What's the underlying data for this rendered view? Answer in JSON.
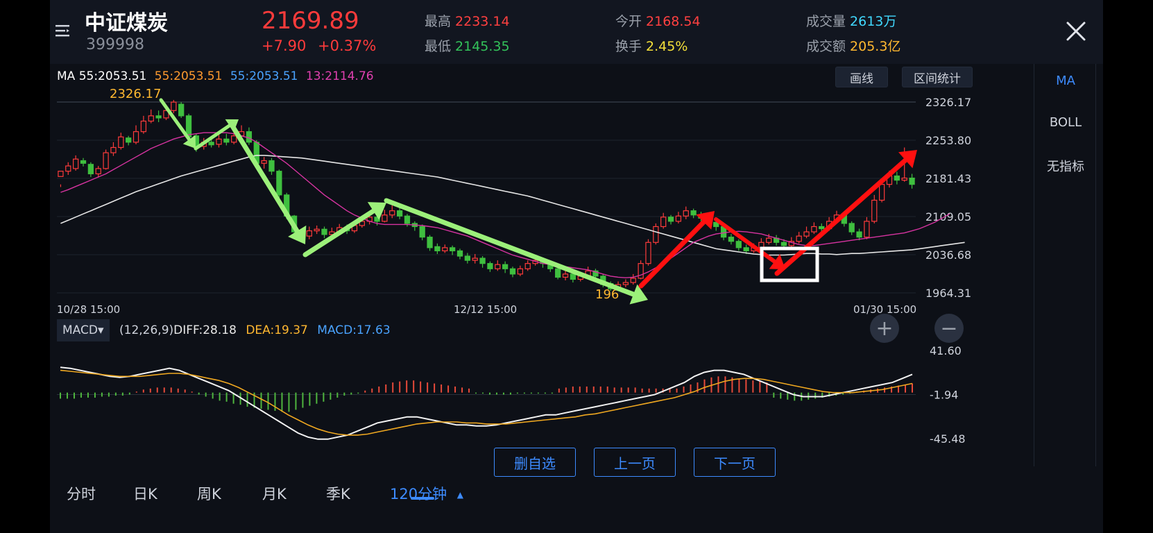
{
  "header": {
    "stock_name": "中证煤炭",
    "stock_code": "399998",
    "price": "2169.89",
    "change": "+7.90",
    "change_pct": "+0.37%",
    "high_label": "最高",
    "high_value": "2233.14",
    "low_label": "最低",
    "low_value": "2145.35",
    "open_label": "今开",
    "open_value": "2168.54",
    "turnover_label": "换手",
    "turnover_value": "2.45%",
    "volume_label": "成交量",
    "volume_value": "2613万",
    "amount_label": "成交额",
    "amount_value": "205.3亿"
  },
  "legend": {
    "ma_prefix": "MA 55:2053.51",
    "ma_orange": "55:2053.51",
    "ma_blue": "55:2053.51",
    "ma_pink": "13:2114.76"
  },
  "toolbar": {
    "draw_label": "画线",
    "range_label": "区间统计"
  },
  "side": {
    "items": [
      "MA",
      "BOLL",
      "无指标"
    ]
  },
  "chart_data": {
    "type": "candlestick",
    "y_ticks": [
      "2326.17",
      "2253.80",
      "2181.43",
      "2109.05",
      "2036.68",
      "1964.31"
    ],
    "y_range": [
      1964.31,
      2326.17
    ],
    "x_labels": [
      "10/28  15:00",
      "12/12  15:00",
      "01/30  15:00"
    ],
    "high_label": "2326.17",
    "low_label": "196",
    "candles": [
      [
        2185,
        2195,
        2170,
        2165
      ],
      [
        2195,
        2205,
        2212,
        2188
      ],
      [
        2200,
        2218,
        2225,
        2196
      ],
      [
        2215,
        2210,
        2220,
        2204
      ],
      [
        2208,
        2190,
        2212,
        2184
      ],
      [
        2190,
        2200,
        2205,
        2183
      ],
      [
        2200,
        2230,
        2236,
        2198
      ],
      [
        2230,
        2240,
        2250,
        2224
      ],
      [
        2240,
        2260,
        2268,
        2236
      ],
      [
        2258,
        2250,
        2262,
        2244
      ],
      [
        2250,
        2270,
        2282,
        2246
      ],
      [
        2270,
        2290,
        2300,
        2266
      ],
      [
        2290,
        2300,
        2312,
        2286
      ],
      [
        2300,
        2296,
        2310,
        2288
      ],
      [
        2296,
        2310,
        2320,
        2292
      ],
      [
        2310,
        2326,
        2330,
        2305
      ],
      [
        2322,
        2300,
        2326,
        2296
      ],
      [
        2300,
        2260,
        2304,
        2255
      ],
      [
        2262,
        2240,
        2266,
        2232
      ],
      [
        2242,
        2250,
        2258,
        2236
      ],
      [
        2250,
        2245,
        2256,
        2240
      ],
      [
        2246,
        2256,
        2264,
        2240
      ],
      [
        2256,
        2250,
        2266,
        2244
      ],
      [
        2250,
        2262,
        2270,
        2246
      ],
      [
        2262,
        2270,
        2282,
        2256
      ],
      [
        2270,
        2250,
        2278,
        2245
      ],
      [
        2250,
        2210,
        2254,
        2205
      ],
      [
        2210,
        2215,
        2222,
        2200
      ],
      [
        2215,
        2195,
        2220,
        2188
      ],
      [
        2195,
        2150,
        2198,
        2144
      ],
      [
        2150,
        2110,
        2154,
        2104
      ],
      [
        2110,
        2080,
        2112,
        2072
      ],
      [
        2082,
        2070,
        2086,
        2062
      ],
      [
        2072,
        2082,
        2090,
        2066
      ],
      [
        2082,
        2085,
        2092,
        2076
      ],
      [
        2085,
        2075,
        2090,
        2068
      ],
      [
        2075,
        2080,
        2088,
        2070
      ],
      [
        2080,
        2088,
        2095,
        2074
      ],
      [
        2088,
        2082,
        2094,
        2076
      ],
      [
        2082,
        2092,
        2098,
        2078
      ],
      [
        2092,
        2100,
        2108,
        2088
      ],
      [
        2100,
        2108,
        2116,
        2094
      ],
      [
        2108,
        2100,
        2112,
        2092
      ],
      [
        2100,
        2112,
        2122,
        2098
      ],
      [
        2112,
        2120,
        2130,
        2106
      ],
      [
        2120,
        2110,
        2126,
        2104
      ],
      [
        2110,
        2096,
        2114,
        2090
      ],
      [
        2096,
        2090,
        2100,
        2082
      ],
      [
        2090,
        2070,
        2094,
        2064
      ],
      [
        2070,
        2050,
        2074,
        2044
      ],
      [
        2052,
        2044,
        2058,
        2038
      ],
      [
        2044,
        2050,
        2056,
        2040
      ],
      [
        2050,
        2044,
        2054,
        2036
      ],
      [
        2044,
        2034,
        2048,
        2028
      ],
      [
        2034,
        2026,
        2040,
        2020
      ],
      [
        2026,
        2030,
        2038,
        2020
      ],
      [
        2030,
        2020,
        2034,
        2012
      ],
      [
        2020,
        2010,
        2024,
        2004
      ],
      [
        2010,
        2018,
        2026,
        2006
      ],
      [
        2018,
        2010,
        2024,
        2002
      ],
      [
        2010,
        2000,
        2014,
        1994
      ],
      [
        2000,
        2010,
        2016,
        1996
      ],
      [
        2010,
        2020,
        2026,
        2006
      ],
      [
        2020,
        2026,
        2034,
        2016
      ],
      [
        2026,
        2020,
        2030,
        2012
      ],
      [
        2020,
        2010,
        2026,
        2004
      ],
      [
        2010,
        1994,
        2014,
        1990
      ],
      [
        1994,
        2000,
        2006,
        1988
      ],
      [
        2000,
        1990,
        2004,
        1984
      ],
      [
        1990,
        1996,
        2002,
        1986
      ],
      [
        1996,
        2006,
        2014,
        1992
      ],
      [
        2006,
        1996,
        2010,
        1986
      ],
      [
        1996,
        1980,
        2000,
        1975
      ],
      [
        1982,
        1972,
        1986,
        1968
      ],
      [
        1972,
        1980,
        1986,
        1968
      ],
      [
        1980,
        1984,
        1990,
        1975
      ],
      [
        1984,
        1992,
        2000,
        1980
      ],
      [
        1992,
        2020,
        2026,
        1990
      ],
      [
        2020,
        2060,
        2066,
        2016
      ],
      [
        2060,
        2090,
        2096,
        2056
      ],
      [
        2090,
        2108,
        2116,
        2086
      ],
      [
        2108,
        2100,
        2112,
        2094
      ],
      [
        2100,
        2110,
        2118,
        2096
      ],
      [
        2110,
        2120,
        2128,
        2104
      ],
      [
        2120,
        2112,
        2124,
        2106
      ],
      [
        2112,
        2106,
        2118,
        2100
      ],
      [
        2106,
        2098,
        2110,
        2092
      ],
      [
        2098,
        2090,
        2102,
        2082
      ],
      [
        2090,
        2070,
        2094,
        2064
      ],
      [
        2070,
        2062,
        2076,
        2056
      ],
      [
        2062,
        2050,
        2066,
        2044
      ],
      [
        2050,
        2044,
        2056,
        2038
      ],
      [
        2044,
        2050,
        2058,
        2040
      ],
      [
        2050,
        2060,
        2068,
        2046
      ],
      [
        2060,
        2068,
        2076,
        2056
      ],
      [
        2068,
        2060,
        2074,
        2054
      ],
      [
        2060,
        2054,
        2066,
        2048
      ],
      [
        2054,
        2062,
        2070,
        2050
      ],
      [
        2062,
        2072,
        2080,
        2058
      ],
      [
        2072,
        2080,
        2090,
        2068
      ],
      [
        2080,
        2090,
        2098,
        2076
      ],
      [
        2090,
        2086,
        2096,
        2080
      ],
      [
        2086,
        2100,
        2108,
        2082
      ],
      [
        2100,
        2112,
        2120,
        2096
      ],
      [
        2112,
        2096,
        2116,
        2090
      ],
      [
        2096,
        2080,
        2100,
        2074
      ],
      [
        2080,
        2070,
        2086,
        2064
      ],
      [
        2070,
        2100,
        2108,
        2066
      ],
      [
        2100,
        2140,
        2150,
        2096
      ],
      [
        2140,
        2170,
        2180,
        2136
      ],
      [
        2170,
        2186,
        2196,
        2164
      ],
      [
        2186,
        2178,
        2194,
        2170
      ],
      [
        2178,
        2182,
        2240,
        2175
      ],
      [
        2182,
        2170,
        2190,
        2162
      ]
    ],
    "ma_slow": [
      2096,
      2102,
      2108,
      2114,
      2120,
      2126,
      2132,
      2138,
      2144,
      2150,
      2156,
      2161,
      2166,
      2171,
      2176,
      2181,
      2186,
      2190,
      2194,
      2198,
      2202,
      2206,
      2210,
      2214,
      2218,
      2222,
      2225,
      2225,
      2224,
      2223,
      2222,
      2221,
      2220,
      2218,
      2216,
      2214,
      2212,
      2210,
      2208,
      2206,
      2204,
      2202,
      2200,
      2198,
      2196,
      2194,
      2192,
      2190,
      2188,
      2186,
      2184,
      2181,
      2178,
      2175,
      2172,
      2169,
      2166,
      2163,
      2160,
      2157,
      2154,
      2151,
      2148,
      2144,
      2140,
      2136,
      2132,
      2128,
      2124,
      2120,
      2116,
      2112,
      2108,
      2104,
      2100,
      2096,
      2092,
      2088,
      2084,
      2080,
      2076,
      2072,
      2068,
      2064,
      2060,
      2056,
      2052,
      2048,
      2046,
      2044,
      2042,
      2040,
      2038,
      2037,
      2036,
      2036,
      2036,
      2037,
      2038,
      2039,
      2039,
      2038,
      2038,
      2037,
      2038,
      2039,
      2039,
      2040,
      2041,
      2042,
      2043,
      2044,
      2045,
      2046,
      2048,
      2050,
      2052,
      2054,
      2056,
      2058,
      2060
    ],
    "ma_fast": [
      2155,
      2160,
      2166,
      2172,
      2178,
      2184,
      2190,
      2198,
      2206,
      2214,
      2222,
      2230,
      2238,
      2244,
      2250,
      2256,
      2260,
      2264,
      2266,
      2268,
      2268,
      2268,
      2268,
      2266,
      2262,
      2258,
      2250,
      2240,
      2230,
      2220,
      2210,
      2198,
      2186,
      2174,
      2162,
      2150,
      2140,
      2130,
      2120,
      2112,
      2106,
      2100,
      2096,
      2094,
      2094,
      2094,
      2094,
      2093,
      2092,
      2090,
      2088,
      2084,
      2080,
      2076,
      2072,
      2066,
      2060,
      2054,
      2048,
      2042,
      2036,
      2032,
      2028,
      2024,
      2020,
      2018,
      2016,
      2014,
      2012,
      2010,
      2008,
      2004,
      2000,
      1996,
      1994,
      1993,
      1994,
      1998,
      2004,
      2012,
      2020,
      2030,
      2040,
      2050,
      2060,
      2066,
      2072,
      2076,
      2078,
      2080,
      2081,
      2080,
      2078,
      2076,
      2072,
      2068,
      2064,
      2060,
      2056,
      2054,
      2054,
      2056,
      2058,
      2060,
      2062,
      2064,
      2066,
      2068,
      2070,
      2072,
      2074,
      2076,
      2078,
      2082,
      2086,
      2092,
      2098,
      2106,
      2114
    ]
  },
  "macd": {
    "selector_label": "MACD▾",
    "params": "(12,26,9)",
    "diff": "DIFF:28.18",
    "dea": "DEA:19.37",
    "macd": "MACD:17.63",
    "y_ticks": [
      "41.60",
      "-1.94",
      "-45.48"
    ],
    "y_range": [
      -45.48,
      41.6
    ],
    "bars": [
      -6,
      -6,
      -6,
      -5,
      -5,
      -5,
      -4,
      -4,
      -3,
      -3,
      -2,
      1,
      3,
      4,
      5,
      5,
      5,
      4,
      3,
      1,
      -2,
      -4,
      -6,
      -8,
      -9,
      -11,
      -12,
      -14,
      -15,
      -16,
      -17,
      -18,
      -19,
      -19,
      -17,
      -15,
      -13,
      -11,
      -9,
      -7,
      -5,
      -3,
      -2,
      -1,
      2,
      4,
      6,
      8,
      10,
      11,
      12,
      12,
      11,
      10,
      9,
      8,
      7,
      6,
      5,
      4,
      -1,
      -1,
      -2,
      -2,
      -2,
      -2,
      -1,
      -1,
      -1,
      -1,
      -1,
      -1,
      4,
      5,
      6,
      6,
      6,
      6,
      6,
      6,
      5,
      5,
      5,
      5,
      4,
      4,
      4,
      4,
      4,
      4,
      6,
      8,
      10,
      13,
      15,
      16,
      16,
      15,
      14,
      13,
      12,
      11,
      10,
      -5,
      -6,
      -7,
      -8,
      -8,
      -7,
      -6,
      -5,
      -4,
      -3,
      -2,
      -1,
      1,
      2,
      3,
      4,
      5,
      6,
      7,
      8,
      9
    ],
    "diff_line": [
      25,
      24,
      22,
      20,
      18,
      16,
      15,
      16,
      18,
      20,
      22,
      24,
      22,
      18,
      14,
      10,
      6,
      2,
      -4,
      -10,
      -16,
      -22,
      -28,
      -34,
      -40,
      -44,
      -46,
      -46,
      -44,
      -42,
      -38,
      -34,
      -30,
      -28,
      -26,
      -24,
      -24,
      -26,
      -28,
      -30,
      -32,
      -32,
      -33,
      -33,
      -32,
      -30,
      -28,
      -26,
      -24,
      -22,
      -22,
      -20,
      -18,
      -16,
      -14,
      -12,
      -10,
      -8,
      -6,
      -4,
      -2,
      2,
      6,
      10,
      16,
      20,
      22,
      22,
      20,
      18,
      14,
      10,
      6,
      2,
      -2,
      -4,
      -4,
      -4,
      -2,
      0,
      2,
      4,
      6,
      8,
      10,
      14,
      18
    ],
    "dea_line": [
      22,
      21,
      20,
      19,
      18,
      17,
      16,
      16,
      16,
      17,
      18,
      19,
      19,
      18,
      16,
      14,
      12,
      9,
      5,
      0,
      -5,
      -10,
      -16,
      -22,
      -27,
      -32,
      -36,
      -39,
      -41,
      -42,
      -42,
      -41,
      -39,
      -37,
      -35,
      -33,
      -31,
      -30,
      -29,
      -29,
      -29,
      -30,
      -30,
      -31,
      -31,
      -31,
      -30,
      -29,
      -28,
      -27,
      -26,
      -25,
      -24,
      -22,
      -21,
      -19,
      -17,
      -15,
      -13,
      -11,
      -9,
      -7,
      -5,
      -2,
      1,
      5,
      8,
      11,
      13,
      14,
      14,
      13,
      11,
      9,
      7,
      5,
      3,
      1,
      0,
      0,
      0,
      1,
      2,
      3,
      5,
      7,
      9
    ]
  },
  "bottom": {
    "tabs": [
      "分时",
      "日K",
      "周K",
      "月K",
      "季K",
      "120分钟"
    ],
    "active_arrow": "▲",
    "actions": [
      "删自选",
      "上一页",
      "下一页"
    ]
  },
  "colors": {
    "up": "#ff3b3b",
    "down": "#3fbf3f",
    "accent": "#3d8bff",
    "ma_fast": "#d633a0",
    "ma_slow": "#e6e6e6"
  }
}
